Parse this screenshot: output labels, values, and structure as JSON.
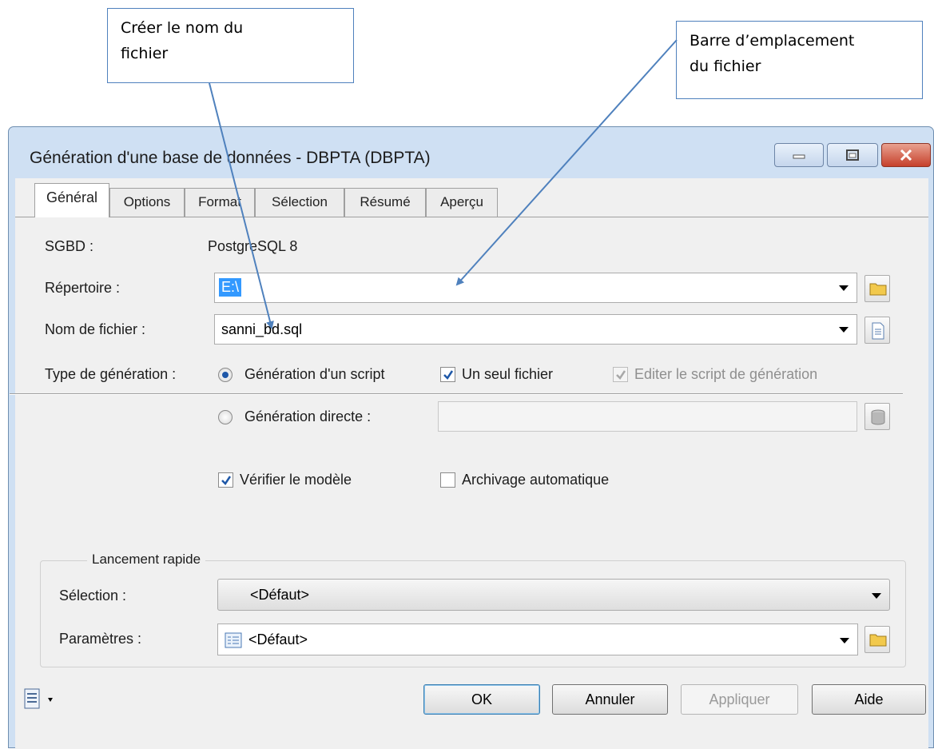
{
  "annotations": {
    "filename_callout": [
      "Créer le nom du",
      "fichier"
    ],
    "location_callout": [
      "Barre d’emplacement",
      "du fichier"
    ]
  },
  "window": {
    "title": "Génération d'une base de données - DBPTA (DBPTA)",
    "controls": [
      "minimize-icon",
      "maximize-icon",
      "close-icon"
    ]
  },
  "tabs": [
    {
      "label": "Général",
      "active": true
    },
    {
      "label": "Options",
      "active": false
    },
    {
      "label": "Format",
      "active": false
    },
    {
      "label": "Sélection",
      "active": false
    },
    {
      "label": "Résumé",
      "active": false
    },
    {
      "label": "Aperçu",
      "active": false
    }
  ],
  "general": {
    "sgbd_label": "SGBD :",
    "sgbd_value": "PostgreSQL 8",
    "repertoire_label": "Répertoire :",
    "repertoire_value": "E:\\",
    "nom_fichier_label": "Nom de fichier :",
    "nom_fichier_value": "sanni_bd.sql",
    "type_generation_label": "Type de génération :",
    "radio_script": "Génération d'un script",
    "radio_directe": "Génération directe :",
    "check_un_seul_fichier": "Un seul fichier",
    "check_editer_script": "Editer le script de génération",
    "check_verifier": "Vérifier le modèle",
    "check_archivage": "Archivage automatique",
    "states": {
      "script_selected": true,
      "un_seul_fichier": true,
      "editer_script": true,
      "verifier": true,
      "archivage": false
    }
  },
  "lancement_rapide": {
    "title": "Lancement rapide",
    "selection_label": "Sélection :",
    "selection_value": "<Défaut>",
    "parametres_label": "Paramètres :",
    "parametres_value": "<Défaut>"
  },
  "buttons": {
    "ok": "OK",
    "annuler": "Annuler",
    "appliquer": "Appliquer",
    "aide": "Aide"
  },
  "colors": {
    "annotation_border": "#4f81bd",
    "arrow": "#4f81bd",
    "close_button": "#c6402b",
    "selection_highlight": "#3399ff"
  }
}
